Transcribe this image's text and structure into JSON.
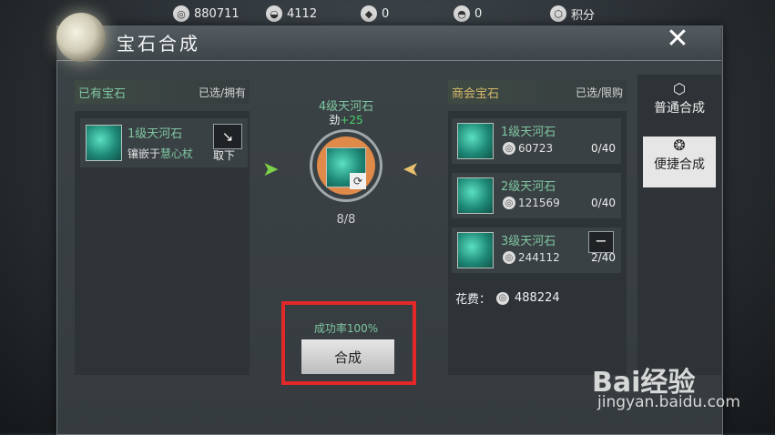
{
  "topbar": {
    "items": [
      {
        "icon": "coin-icon",
        "value": "880711"
      },
      {
        "icon": "silver-bowl-icon",
        "value": "4112"
      },
      {
        "icon": "jade-icon",
        "value": "0"
      },
      {
        "icon": "gold-bowl-icon",
        "value": "0"
      },
      {
        "icon": "points-icon",
        "value": "积分"
      }
    ]
  },
  "header": {
    "title": "宝石合成",
    "close_label": "✕"
  },
  "left": {
    "title": "已有宝石",
    "subtitle": "已选/拥有",
    "item": {
      "name": "1级天河石",
      "desc_prefix": "镶嵌于",
      "desc_target": "慧心杖",
      "action_label": "取下",
      "action_icon": "↘"
    }
  },
  "center": {
    "title": "4级天河石",
    "stat_label": "劲",
    "stat_value": "+25",
    "count": "8/8",
    "rate": "成功率100%",
    "combine_label": "合成"
  },
  "right": {
    "title": "商会宝石",
    "subtitle": "已选/限购",
    "items": [
      {
        "name": "1级天河石",
        "price": "60723",
        "count": "0/40"
      },
      {
        "name": "2级天河石",
        "price": "121569",
        "count": "0/40"
      },
      {
        "name": "3级天河石",
        "price": "244112",
        "count": "2/40"
      }
    ],
    "cost_label": "花费：",
    "cost_value": "488224"
  },
  "tabs": [
    {
      "label": "普通合成",
      "icon": "hexagon-icon"
    },
    {
      "label": "便捷合成",
      "icon": "swirl-icon"
    }
  ],
  "watermark": {
    "logo": "Bai经验",
    "url": "jingyan.baidu.com"
  },
  "colors": {
    "accent_green": "#7fc6a1",
    "highlight": "#e3282a",
    "gold": "#d8b86a"
  }
}
